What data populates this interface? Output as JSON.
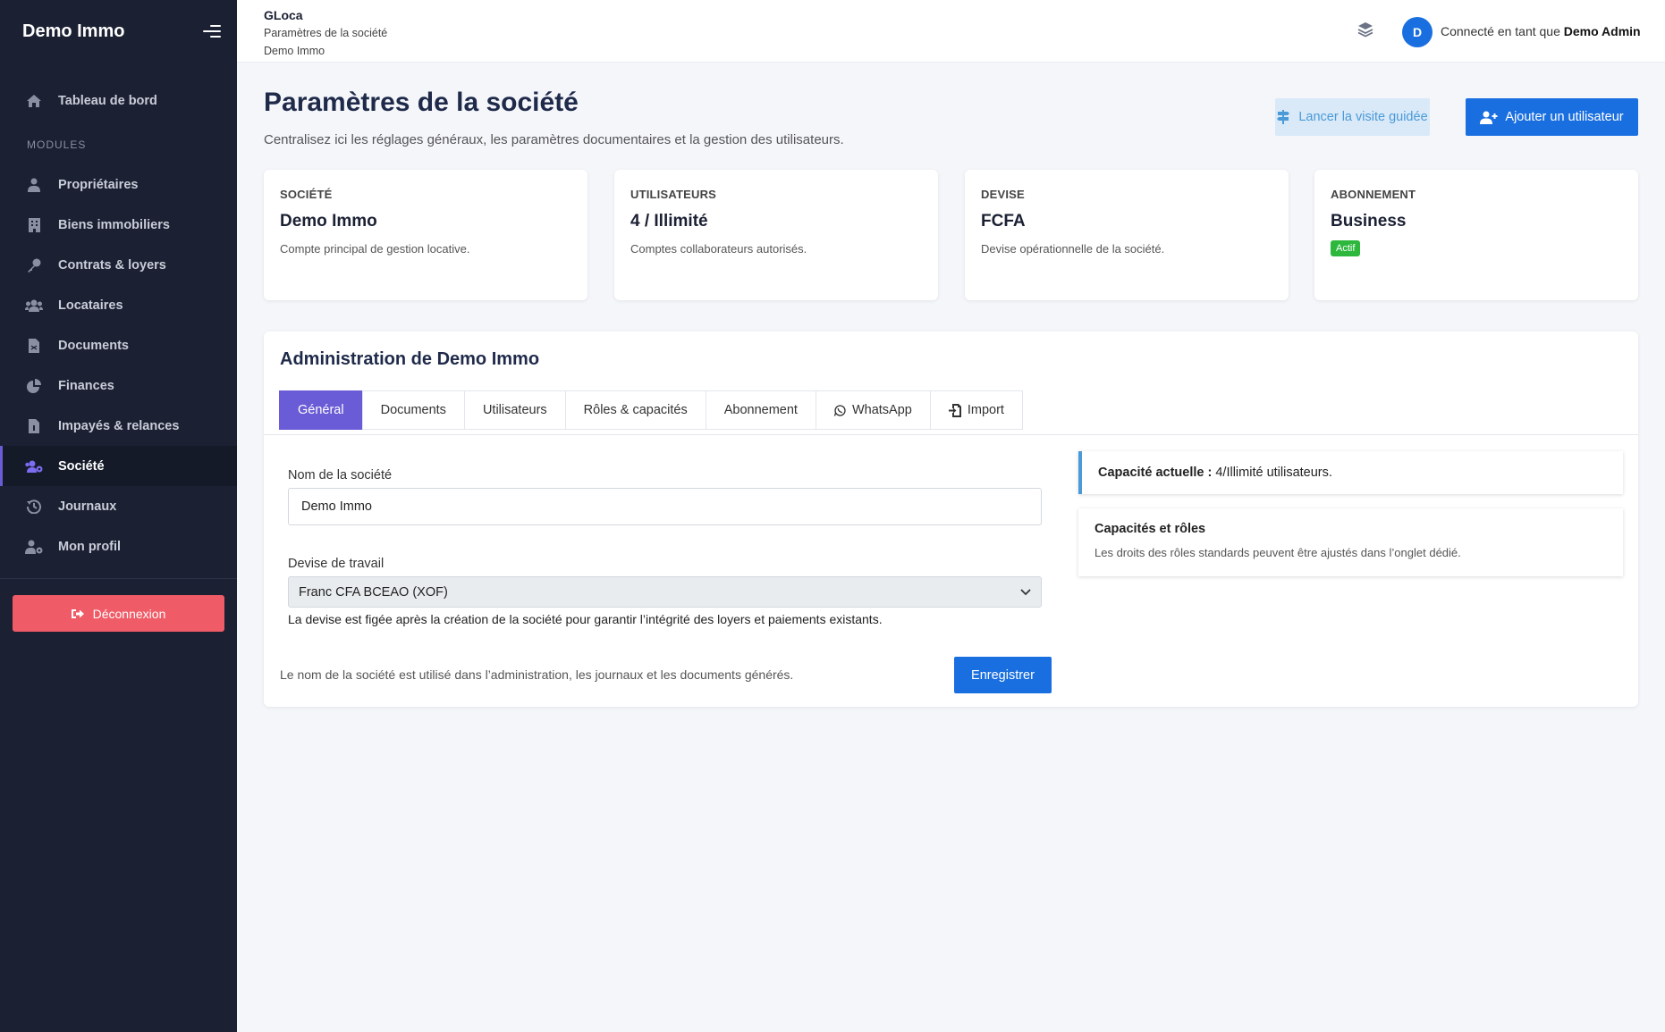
{
  "sidebar": {
    "brand": "Demo Immo",
    "dashboard": "Tableau de bord",
    "section_label": "MODULES",
    "items": [
      {
        "label": "Propriétaires",
        "icon": "user-tie-icon"
      },
      {
        "label": "Biens immobiliers",
        "icon": "building-icon"
      },
      {
        "label": "Contrats & loyers",
        "icon": "key-icon"
      },
      {
        "label": "Locataires",
        "icon": "users-icon"
      },
      {
        "label": "Documents",
        "icon": "file-pdf-icon"
      },
      {
        "label": "Finances",
        "icon": "pie-chart-icon"
      },
      {
        "label": "Impayés & relances",
        "icon": "file-invoice-icon"
      },
      {
        "label": "Société",
        "icon": "users-cog-icon",
        "active": true
      },
      {
        "label": "Journaux",
        "icon": "history-icon"
      },
      {
        "label": "Mon profil",
        "icon": "user-cog-icon"
      }
    ],
    "logout": "Déconnexion"
  },
  "topbar": {
    "app": "GLoca",
    "page": "Paramètres de la société",
    "company": "Demo Immo",
    "avatar_letter": "D",
    "connected_prefix": "Connecté en tant que ",
    "user_name": "Demo Admin"
  },
  "header": {
    "title": "Paramètres de la société",
    "subtitle": "Centralisez ici les réglages généraux, les paramètres documentaires et la gestion des utilisateurs.",
    "tour_button": "Lancer la visite guidée",
    "add_user_button": "Ajouter un utilisateur"
  },
  "stats": [
    {
      "label": "SOCIÉTÉ",
      "value": "Demo Immo",
      "desc": "Compte principal de gestion locative."
    },
    {
      "label": "UTILISATEURS",
      "value": "4 / Illimité",
      "desc": "Comptes collaborateurs autorisés."
    },
    {
      "label": "DEVISE",
      "value": "FCFA",
      "desc": "Devise opérationnelle de la société."
    },
    {
      "label": "ABONNEMENT",
      "value": "Business",
      "badge": "Actif"
    }
  ],
  "panel": {
    "title": "Administration de Demo Immo",
    "tabs": [
      "Général",
      "Documents",
      "Utilisateurs",
      "Rôles & capacités",
      "Abonnement",
      "WhatsApp",
      "Import"
    ],
    "active_tab": "Général",
    "form": {
      "name_label": "Nom de la société",
      "name_value": "Demo Immo",
      "currency_label": "Devise de travail",
      "currency_value": "Franc CFA BCEAO (XOF)",
      "currency_help": "La devise est figée après la création de la société pour garantir l’intégrité des loyers et paiements existants.",
      "footer_note": "Le nom de la société est utilisé dans l’administration, les journaux et les documents générés.",
      "save_button": "Enregistrer"
    },
    "capacity": {
      "label": "Capacité actuelle :",
      "value": " 4/Illimité utilisateurs."
    },
    "roles_card": {
      "title": "Capacités et rôles",
      "text": "Les droits des rôles standards peuvent être ajustés dans l’onglet dédié."
    }
  },
  "colors": {
    "sidebar_bg": "#1b2033",
    "primary": "#1a6fe0",
    "active_tab": "#6a5bd6",
    "logout": "#ef5b66",
    "badge_success": "#2db83d",
    "info_border": "#4a9ad8"
  }
}
